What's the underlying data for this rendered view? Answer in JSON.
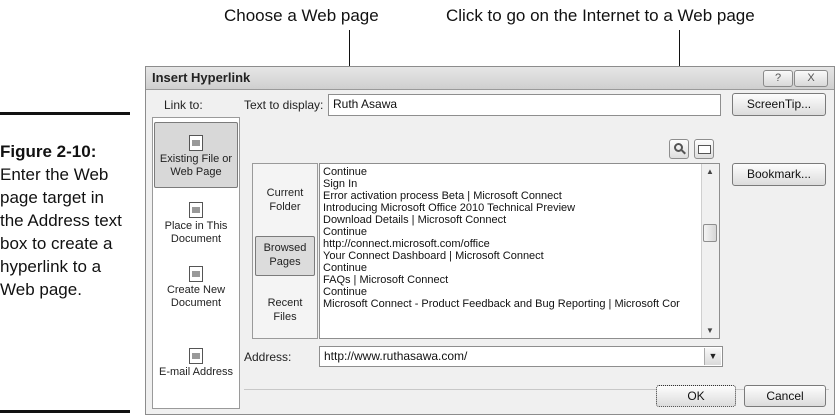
{
  "callouts": {
    "left": "Choose a Web page",
    "right": "Click to go on the Internet to a Web page"
  },
  "figure": {
    "number": "Figure 2-10:",
    "caption": "Enter the Web page target in the Address text box to create a hyperlink to a Web page."
  },
  "dialog": {
    "title": "Insert Hyperlink",
    "help_glyph": "?",
    "close_glyph": "X",
    "link_to_label": "Link to:",
    "text_to_display_label": "Text to display:",
    "text_to_display_value": "Ruth Asawa",
    "screentip_button": "ScreenTip...",
    "bookmark_button": "Bookmark...",
    "link_to_items": [
      {
        "label": "Existing File or Web Page",
        "icon": "existing-file-icon",
        "selected": true
      },
      {
        "label": "Place in This Document",
        "icon": "place-in-document-icon",
        "selected": false
      },
      {
        "label": "Create New Document",
        "icon": "new-document-icon",
        "selected": false
      },
      {
        "label": "E-mail Address",
        "icon": "email-icon",
        "selected": false
      }
    ],
    "look_in_items": [
      {
        "label": "Current Folder",
        "selected": false
      },
      {
        "label": "Browsed Pages",
        "selected": true
      },
      {
        "label": "Recent Files",
        "selected": false
      }
    ],
    "browsed_pages": [
      "Continue",
      "Sign In",
      "Error activation process Beta | Microsoft Connect",
      "Introducing Microsoft Office 2010 Technical Preview",
      "Download Details | Microsoft Connect",
      "Continue",
      "http://connect.microsoft.com/office",
      "Your Connect Dashboard | Microsoft Connect",
      "Continue",
      "FAQs | Microsoft Connect",
      "Continue",
      "Microsoft Connect - Product Feedback and Bug Reporting | Microsoft Cor"
    ],
    "address_label": "Address:",
    "address_value": "http://www.ruthasawa.com/",
    "ok_button": "OK",
    "cancel_button": "Cancel"
  }
}
